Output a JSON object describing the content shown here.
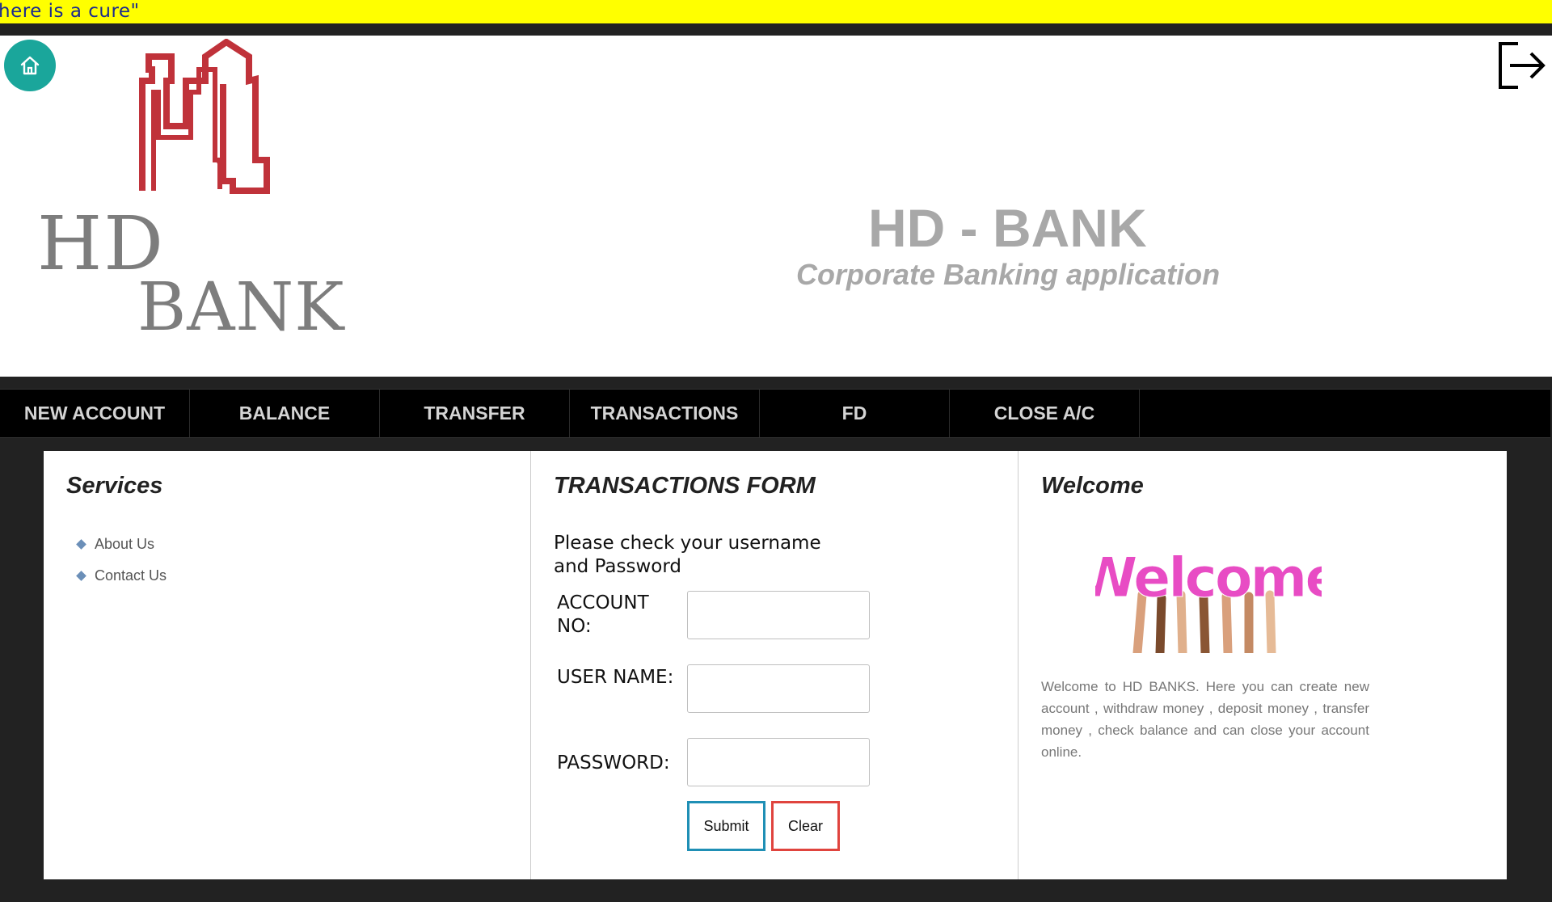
{
  "marquee": {
    "text": "here is a cure\""
  },
  "header": {
    "logo_line1": "HD",
    "logo_line2": "BANK",
    "title": "HD - BANK",
    "subtitle": "Corporate Banking application",
    "home_icon": "home-icon",
    "logout_icon": "logout-icon"
  },
  "nav": {
    "items": [
      {
        "label": "NEW ACCOUNT"
      },
      {
        "label": "BALANCE"
      },
      {
        "label": "TRANSFER"
      },
      {
        "label": "TRANSACTIONS"
      },
      {
        "label": "FD"
      },
      {
        "label": "CLOSE A/C"
      }
    ]
  },
  "services": {
    "title": "Services",
    "items": [
      {
        "label": "About Us"
      },
      {
        "label": "Contact Us"
      }
    ]
  },
  "form": {
    "title": "TRANSACTIONS FORM",
    "note": "Please check your username and Password",
    "account_label": "ACCOUNT NO:",
    "username_label": "USER NAME:",
    "password_label": "PASSWORD:",
    "account_value": "",
    "username_value": "",
    "password_value": "",
    "submit_label": "Submit",
    "clear_label": "Clear"
  },
  "welcome": {
    "title": "Welcome",
    "image_word": "Welcome",
    "text": "Welcome to HD BANKS. Here you can create new account , withdraw money , deposit money , transfer money , check balance and can close your account online."
  },
  "colors": {
    "marquee_bg": "#ffff00",
    "home_button": "#1aa69b",
    "logo_red": "#c0323a",
    "submit_border": "#1f8fb5",
    "clear_border": "#e0443e"
  }
}
